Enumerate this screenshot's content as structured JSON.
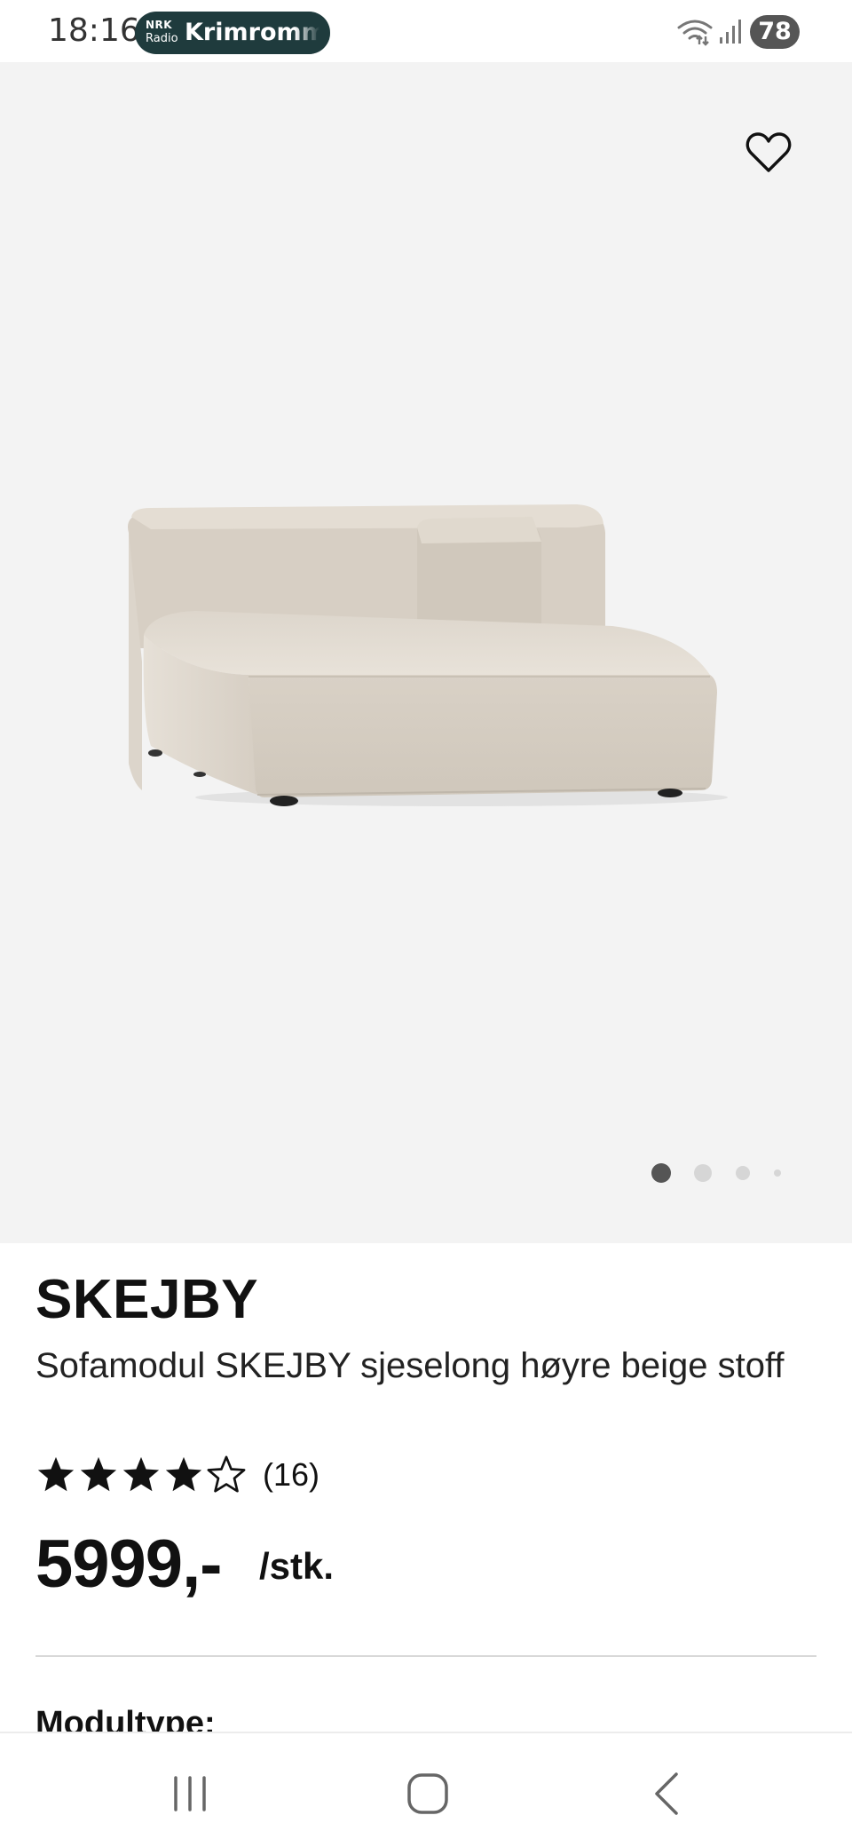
{
  "status_bar": {
    "time": "18:16",
    "media": {
      "app_logo_top": "NRK",
      "app_logo_bottom": "Radio",
      "title": "Krimrommet"
    },
    "battery_level": "78",
    "icons": [
      "wifi-icon",
      "signal-icon"
    ]
  },
  "gallery": {
    "wishlist_icon": "heart-outline-icon",
    "image_description_icon": "product-image",
    "page_count": 4,
    "active_page": 1,
    "colors": {
      "background": "#f3f3f3",
      "dot_active": "#555555",
      "dot_inactive": "#d6d6d6"
    }
  },
  "product": {
    "brand": "SKEJBY",
    "description": "Sofamodul SKEJBY sjeselong høyre beige stoff",
    "rating": 4,
    "rating_max": 5,
    "review_count": "(16)",
    "price": "5999,-",
    "unit": "/stk.",
    "next_section_label": "Modultype:"
  },
  "nav_bar": {
    "buttons": [
      "recent-apps-icon",
      "home-icon",
      "back-icon"
    ]
  }
}
